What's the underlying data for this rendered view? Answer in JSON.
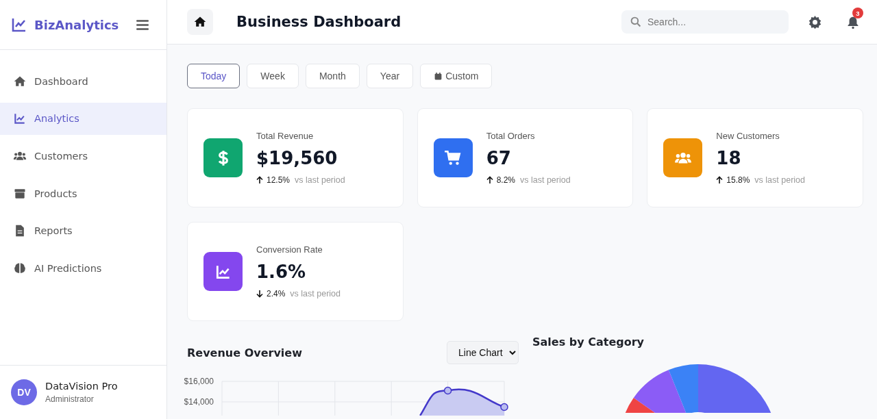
{
  "sidebar": {
    "brand": "BizAnalytics",
    "items": [
      {
        "label": "Dashboard",
        "selected": false
      },
      {
        "label": "Analytics",
        "selected": true
      },
      {
        "label": "Customers",
        "selected": false
      },
      {
        "label": "Products",
        "selected": false
      },
      {
        "label": "Reports",
        "selected": false
      },
      {
        "label": "AI Predictions",
        "selected": false
      }
    ],
    "user": {
      "initials": "DV",
      "name": "DataVision Pro",
      "role": "Administrator"
    }
  },
  "header": {
    "title": "Business Dashboard",
    "search": {
      "placeholder": "Search..."
    },
    "notifications": "3"
  },
  "periods": [
    {
      "label": "Today",
      "selected": true
    },
    {
      "label": "Week",
      "selected": false
    },
    {
      "label": "Month",
      "selected": false
    },
    {
      "label": "Year",
      "selected": false
    },
    {
      "label": "Custom",
      "selected": false
    }
  ],
  "stats": [
    {
      "label": "Total Revenue",
      "value": "$19,560",
      "increase": true,
      "change": "12.5%",
      "note": "vs last period",
      "color": "#10a670"
    },
    {
      "label": "Total Orders",
      "value": "67",
      "increase": true,
      "change": "8.2%",
      "note": "vs last period",
      "color": "#2f6ff0"
    },
    {
      "label": "New Customers",
      "value": "18",
      "increase": true,
      "change": "15.8%",
      "note": "vs last period",
      "color": "#ee9308"
    },
    {
      "label": "Conversion Rate",
      "value": "1.6%",
      "increase": false,
      "change": "2.4%",
      "note": "vs last period",
      "color": "#8447ee"
    }
  ],
  "revenue": {
    "title": "Revenue Overview",
    "chart_type": "Line Chart",
    "y_labels": [
      "$16,000",
      "$14,000"
    ]
  },
  "sales": {
    "title": "Sales by Category"
  }
}
